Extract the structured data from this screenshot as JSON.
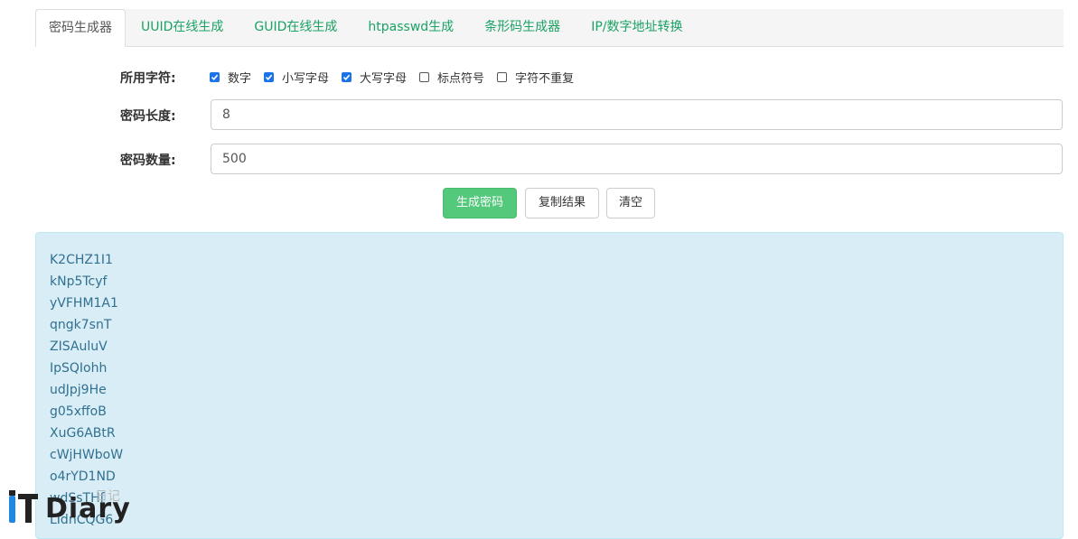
{
  "tabs": [
    {
      "label": "密码生成器",
      "active": true
    },
    {
      "label": "UUID在线生成",
      "active": false
    },
    {
      "label": "GUID在线生成",
      "active": false
    },
    {
      "label": "htpasswd生成",
      "active": false
    },
    {
      "label": "条形码生成器",
      "active": false
    },
    {
      "label": "IP/数字地址转换",
      "active": false
    }
  ],
  "form": {
    "charset_label": "所用字符:",
    "options": [
      {
        "label": "数字",
        "checked": true
      },
      {
        "label": "小写字母",
        "checked": true
      },
      {
        "label": "大写字母",
        "checked": true
      },
      {
        "label": "标点符号",
        "checked": false
      },
      {
        "label": "字符不重复",
        "checked": false
      }
    ],
    "length_label": "密码长度:",
    "length_value": "8",
    "count_label": "密码数量:",
    "count_value": "500"
  },
  "buttons": {
    "generate": "生成密码",
    "copy": "复制结果",
    "clear": "清空"
  },
  "results": [
    "K2CHZ1I1",
    "kNp5Tcyf",
    "yVFHM1A1",
    "qngk7snT",
    "ZISAuluV",
    "IpSQIohh",
    "udJpj9He",
    "g05xffoB",
    "XuG6ABtR",
    "cWjHWboW",
    "o4rYD1ND",
    "wdSsTHf",
    "LIdnCQG6"
  ],
  "watermark": {
    "brand": "Diary",
    "sub": "日记"
  },
  "colors": {
    "tab_link": "#1aa264",
    "primary_button": "#55c97b",
    "result_bg": "#d9edf7",
    "result_text": "#31708f",
    "checkbox_checked": "#1a73e8"
  }
}
